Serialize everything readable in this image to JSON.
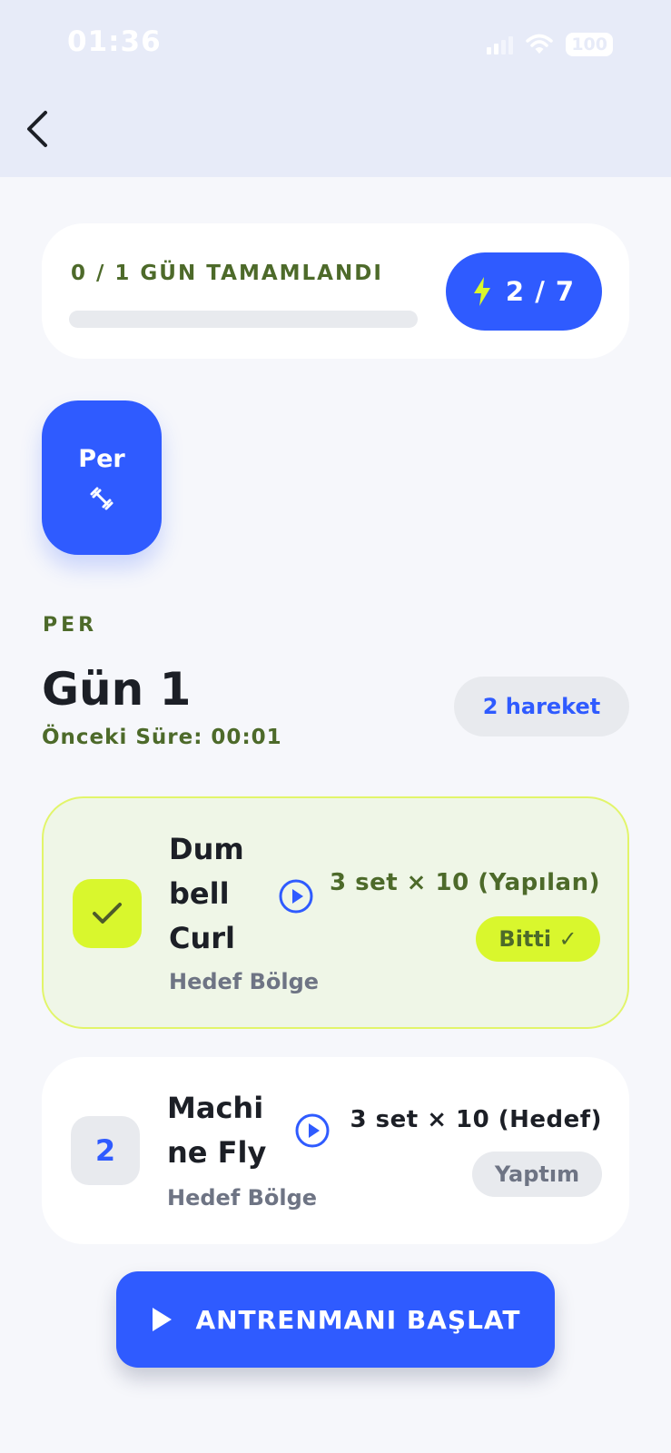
{
  "status_bar": {
    "time": "01:36",
    "battery": "100"
  },
  "header": {
    "back_icon": "chevron-left-icon"
  },
  "progress": {
    "label": "0 / 1 GÜN TAMAMLANDI",
    "completed_fraction": 0,
    "streak_text": "2 / 7",
    "streak_icon": "lightning-icon"
  },
  "day_tabs": [
    {
      "label": "Per",
      "icon": "dumbbell-icon",
      "selected": true
    }
  ],
  "section": {
    "eyebrow": "PER",
    "title": "Gün 1",
    "previous_duration": "Önceki Süre: 00:01",
    "move_count": "2 hareket"
  },
  "exercises": [
    {
      "index": "1",
      "name": "Dum bell Curl",
      "target": "Hedef Bölge",
      "sets": "3 set × 10 (Yapılan)",
      "status": "Bitti ✓",
      "done": true
    },
    {
      "index": "2",
      "name": "Machi ne Fly",
      "target": "Hedef Bölge",
      "sets": "3 set × 10 (Hedef)",
      "status": "Yaptım",
      "done": false
    }
  ],
  "start_button": {
    "label": "ANTRENMANI BAŞLAT",
    "icon": "play-icon"
  },
  "colors": {
    "accent": "#2f5bff",
    "lime": "#d9f72d",
    "olive_text": "#4d6a2a",
    "header_bg": "#e7ebf8",
    "page_bg": "#f6f7fb"
  }
}
